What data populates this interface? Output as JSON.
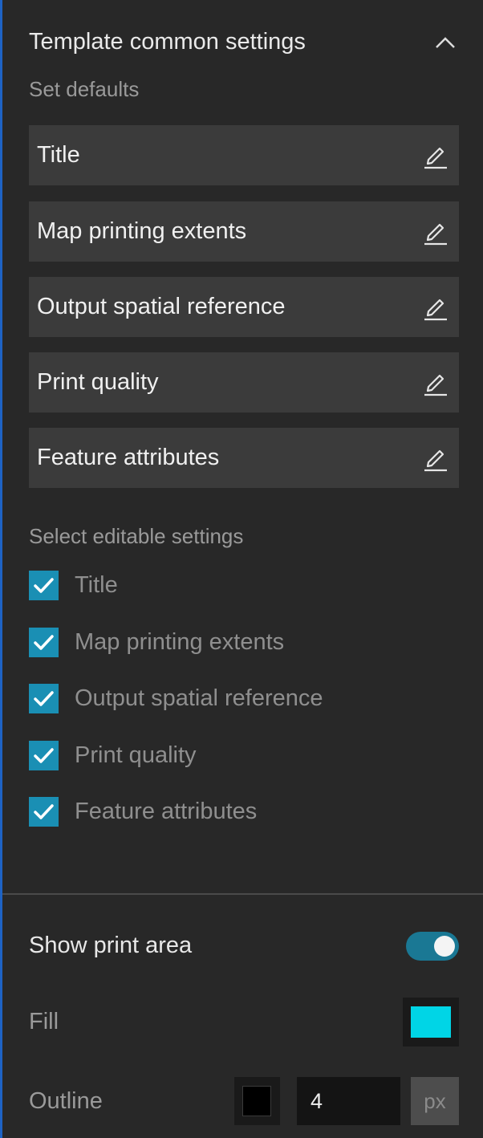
{
  "section": {
    "title": "Template common settings",
    "collapse_icon": "chevron-up-icon"
  },
  "defaults": {
    "heading": "Set defaults",
    "items": [
      {
        "label": "Title",
        "icon": "pencil-icon"
      },
      {
        "label": "Map printing extents",
        "icon": "pencil-icon"
      },
      {
        "label": "Output spatial reference",
        "icon": "pencil-icon"
      },
      {
        "label": "Print quality",
        "icon": "pencil-icon"
      },
      {
        "label": "Feature attributes",
        "icon": "pencil-icon"
      }
    ]
  },
  "editable": {
    "heading": "Select editable settings",
    "items": [
      {
        "label": "Title",
        "checked": true
      },
      {
        "label": "Map printing extents",
        "checked": true
      },
      {
        "label": "Output spatial reference",
        "checked": true
      },
      {
        "label": "Print quality",
        "checked": true
      },
      {
        "label": "Feature attributes",
        "checked": true
      }
    ]
  },
  "print_area": {
    "label": "Show print area",
    "enabled": true,
    "fill_label": "Fill",
    "fill_color": "#00d5e6",
    "outline_label": "Outline",
    "outline_color": "#000000",
    "outline_width": "4",
    "outline_unit": "px"
  },
  "colors": {
    "background": "#282828",
    "item_background": "#3b3b3b",
    "accent": "#1a8fb4",
    "toggle_on": "#1a7894"
  }
}
